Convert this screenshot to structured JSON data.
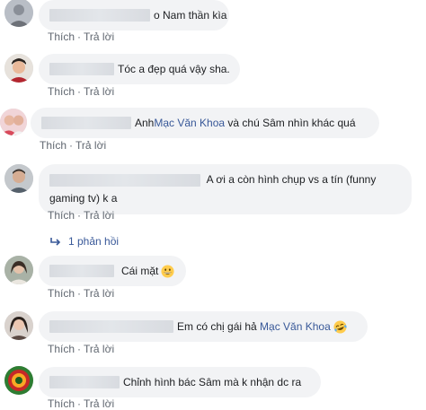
{
  "comments": [
    {
      "text": "o Nam thần kìa"
    },
    {
      "text": "Tóc a đẹp quá vậy sha."
    },
    {
      "prefix": "Anh ",
      "mention": "Mạc Văn Khoa",
      "suffix": " và chú Sâm nhìn khác quá"
    },
    {
      "text": "A ơi a còn hình chụp vs a tín (funny gaming tv) k a"
    },
    {
      "text": "Cái mặt",
      "emoji": "grinning-emoji"
    },
    {
      "prefix": "Em có chị gái hả ",
      "mention": "Mạc Văn Khoa",
      "emoji": "laughing-tears-emoji"
    },
    {
      "text": "Chỉnh hình bác Sâm mà k nhận dc ra"
    }
  ],
  "actions": {
    "like": "Thích",
    "reply": "Trả lời",
    "separator": "·"
  },
  "replies_link": "1 phản hồi",
  "colors": {
    "bubble": "#f2f3f5",
    "link": "#385898",
    "muted": "#606770"
  }
}
